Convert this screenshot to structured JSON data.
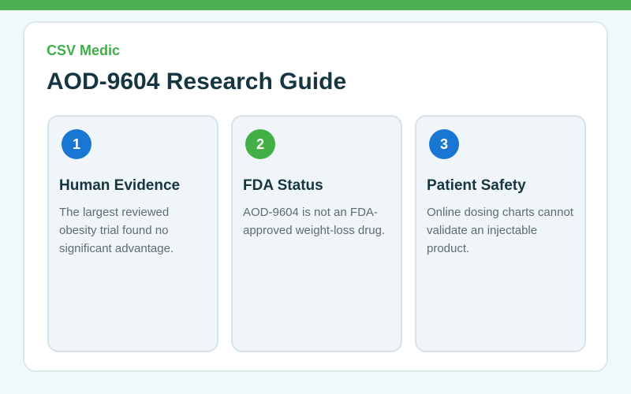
{
  "header": {
    "brand": "CSV Medic",
    "title": "AOD-9604 Research Guide"
  },
  "colors": {
    "accent_green": "#4caf50",
    "badge_blue": "#1976d2",
    "badge_green": "#43b047",
    "heading_text": "#153640"
  },
  "panels": [
    {
      "number": "1",
      "badge_color": "#1976d2",
      "heading": "Human Evidence",
      "text": "The largest reviewed obesity trial found no significant advantage."
    },
    {
      "number": "2",
      "badge_color": "#43b047",
      "heading": "FDA Status",
      "text": "AOD-9604 is not an FDA-approved weight-loss drug."
    },
    {
      "number": "3",
      "badge_color": "#1976d2",
      "heading": "Patient Safety",
      "text": "Online dosing charts cannot validate an injectable product."
    }
  ]
}
